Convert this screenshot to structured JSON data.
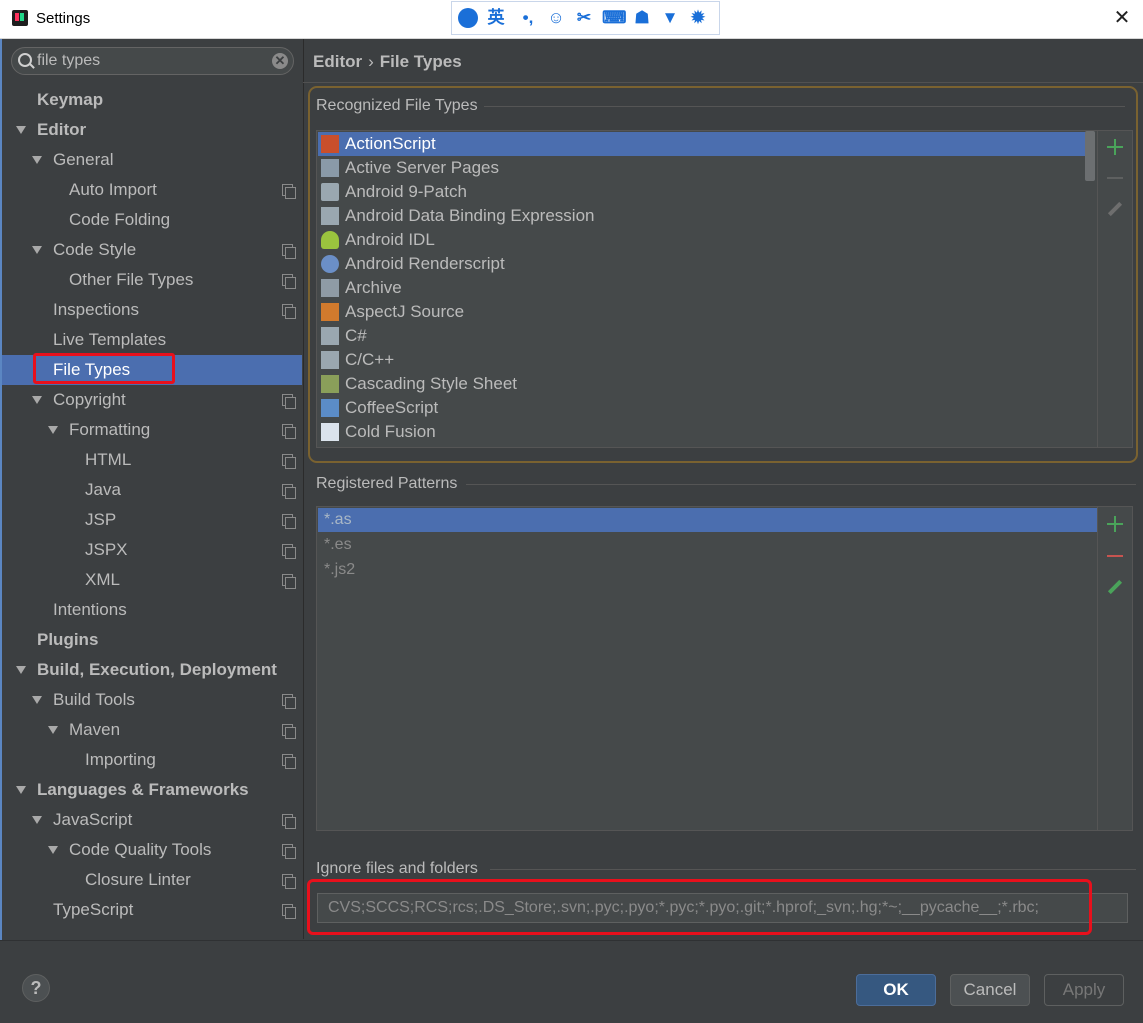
{
  "window": {
    "title": "Settings",
    "close": "✕",
    "ime": {
      "lang": "英",
      "punct": "•,",
      "emoji": "☺",
      "cut": "✂",
      "kbd": "⌨",
      "user": "☗",
      "shirt": "▼",
      "gear": "✹"
    }
  },
  "search": {
    "value": "file types",
    "clear": "✕"
  },
  "tree": {
    "keymap": "Keymap",
    "editor": "Editor",
    "general": "General",
    "auto_import": "Auto Import",
    "code_folding": "Code Folding",
    "code_style": "Code Style",
    "other_file_types": "Other File Types",
    "inspections": "Inspections",
    "live_templates": "Live Templates",
    "file_types": "File Types",
    "copyright": "Copyright",
    "formatting": "Formatting",
    "html": "HTML",
    "java": "Java",
    "jsp": "JSP",
    "jspx": "JSPX",
    "xml": "XML",
    "intentions": "Intentions",
    "plugins": "Plugins",
    "build": "Build, Execution, Deployment",
    "build_tools": "Build Tools",
    "maven": "Maven",
    "importing": "Importing",
    "languages": "Languages & Frameworks",
    "javascript": "JavaScript",
    "code_quality": "Code Quality Tools",
    "closure_linter": "Closure Linter",
    "typescript": "TypeScript"
  },
  "breadcrumb": {
    "parent": "Editor",
    "sep": "›",
    "current": "File Types"
  },
  "recognized": {
    "title": "Recognized File Types",
    "items": [
      {
        "label": "ActionScript",
        "icon": "as-file-icon"
      },
      {
        "label": "Active Server Pages",
        "icon": "asp-file-icon"
      },
      {
        "label": "Android 9-Patch",
        "icon": "folder-icon"
      },
      {
        "label": "Android Data Binding Expression",
        "icon": "file-icon"
      },
      {
        "label": "Android IDL",
        "icon": "android-icon"
      },
      {
        "label": "Android Renderscript",
        "icon": "rs-icon"
      },
      {
        "label": "Archive",
        "icon": "archive-icon"
      },
      {
        "label": "AspectJ Source",
        "icon": "aj-file-icon"
      },
      {
        "label": "C#",
        "icon": "file-icon"
      },
      {
        "label": "C/C++",
        "icon": "file-icon"
      },
      {
        "label": "Cascading Style Sheet",
        "icon": "css-file-icon"
      },
      {
        "label": "CoffeeScript",
        "icon": "coffee-file-icon"
      },
      {
        "label": "Cold Fusion",
        "icon": "cf-file-icon"
      }
    ],
    "selected_index": 0
  },
  "patterns": {
    "title": "Registered Patterns",
    "items": [
      "*.as",
      "*.es",
      "*.js2"
    ],
    "selected_index": 0
  },
  "ignore": {
    "title": "Ignore files and folders",
    "value": "CVS;SCCS;RCS;rcs;.DS_Store;.svn;.pyc;.pyo;*.pyc;*.pyo;.git;*.hprof;_svn;.hg;*~;__pycache__;*.rbc;"
  },
  "footer": {
    "help": "?",
    "ok": "OK",
    "cancel": "Cancel",
    "apply": "Apply"
  },
  "colors": {
    "selection": "#4b6eaf",
    "background": "#3c3f41",
    "highlight_red": "#e8101c",
    "group_border": "#7a6230",
    "add_green": "#4aa35a",
    "remove_red": "#c75450"
  }
}
